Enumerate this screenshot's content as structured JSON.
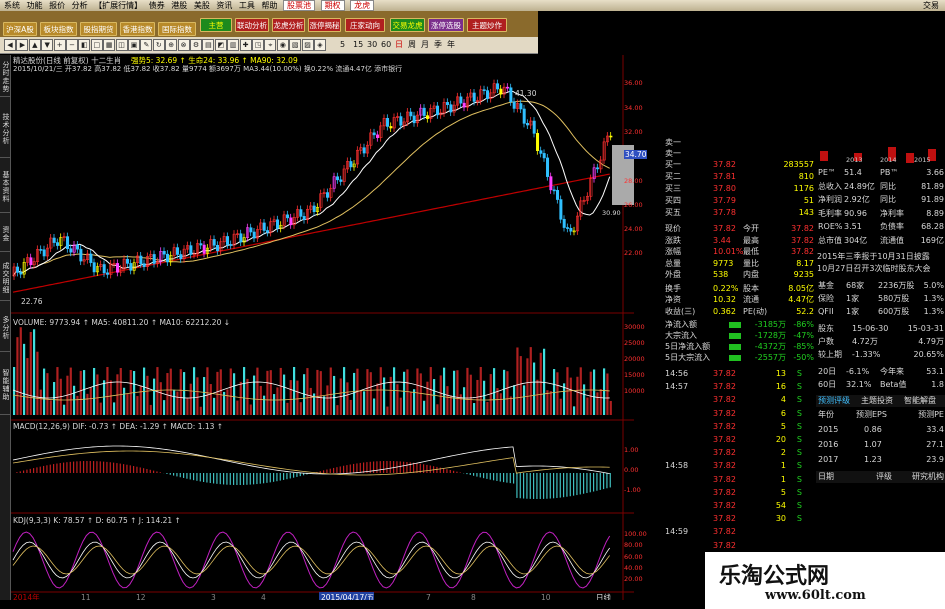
{
  "menubar": {
    "items": [
      "系统",
      "功能",
      "报价",
      "分析",
      "【扩展行情】",
      "资讯",
      "工具",
      "帮助"
    ],
    "hl1": "扩展行情",
    "hl2": "债券",
    "hl3": "港股",
    "hl4": "美股",
    "mid": [
      "资讯",
      "工具",
      "帮助"
    ],
    "right_buttons": [
      "股票池",
      "期权",
      "龙虎"
    ],
    "corner": "交易"
  },
  "toolbar1": [
    {
      "label": "沪深A股",
      "style": "bl"
    },
    {
      "label": "板块指数",
      "style": "bl"
    },
    {
      "label": "股指期货",
      "style": "bl"
    },
    {
      "label": "香港指数",
      "style": "bl"
    },
    {
      "label": "国际指数",
      "style": "bl"
    },
    {
      "label": "主营",
      "style": "gr"
    },
    {
      "label": "联动分析",
      "style": "rd"
    },
    {
      "label": "龙虎分析",
      "style": "rd"
    },
    {
      "label": "涨停揭秘",
      "style": "rd"
    },
    {
      "label": "庄家动向",
      "style": "rd"
    },
    {
      "label": "交易龙虎",
      "style": "gr"
    },
    {
      "label": "涨停选股",
      "style": "pu"
    },
    {
      "label": "主题炒作",
      "style": "rd"
    }
  ],
  "toolbar2": {
    "periods": [
      "5",
      "15",
      "30",
      "60",
      "日",
      "周",
      "月",
      "季",
      "年"
    ]
  },
  "sidebar": [
    "分时走势",
    "技术分析",
    "基本资料",
    "资金",
    "成交明细",
    "多分析",
    "智能辅助"
  ],
  "stock": {
    "name_line": "精达股份(日线 前复权) 十二生肖",
    "indicators": "强势5: 32.69 ↑ 生命24: 33.96 ↑ MA90: 32.09",
    "date_line": "2015/10/21/三  开37.82 高37.82 低37.82 收37.82 量9774 额3697万 MA3.44(10.00%) 换0.22% 流通4.47亿 添市银行",
    "low_label": "22.76",
    "hi_label": "41.30",
    "tag_low": "45"
  },
  "price_axis": [
    "36.00",
    "34.00",
    "32.00",
    "30.00",
    "28.00",
    "26.00",
    "24.00",
    "22.00"
  ],
  "price_box": "34.70",
  "price_box2": "30.90",
  "volume": {
    "header": "VOLUME: 9773.94 ↑ MA5: 40811.20 ↑ MA10: 62212.20 ↓",
    "axis": [
      "30000",
      "25000",
      "20000",
      "15000",
      "10000"
    ],
    "unit": "×100"
  },
  "macd": {
    "header": "MACD(12,26,9) DIF: -0.73 ↑ DEA: -1.29 ↑ MACD: 1.13 ↑",
    "axis": [
      "1.00",
      "0.00",
      "-1.00"
    ]
  },
  "kdj": {
    "header": "KDJ(9,3,3) K: 78.57 ↑ D: 60.75 ↑ J: 114.21 ↑",
    "axis": [
      "100.00",
      "80.00",
      "60.00",
      "40.00",
      "20.00"
    ]
  },
  "xaxis": [
    {
      "t": "2014年",
      "c": "#c00000"
    },
    {
      "t": "11",
      "c": "#888"
    },
    {
      "t": "12",
      "c": "#888"
    },
    {
      "t": "3",
      "c": "#888"
    },
    {
      "t": "4",
      "c": "#888"
    },
    {
      "t": "2015/04/17/五",
      "c": "#4040ff"
    },
    {
      "t": "7",
      "c": "#888"
    },
    {
      "t": "8",
      "c": "#888"
    },
    {
      "t": "10",
      "c": "#888"
    },
    {
      "t": "日线",
      "c": "#ddd"
    }
  ],
  "orderbook": {
    "sell": [
      {
        "l": "卖一",
        "p": "",
        "v": ""
      },
      {
        "l": "卖一",
        "p": "",
        "v": ""
      }
    ],
    "buy": [
      {
        "l": "买一",
        "p": "37.82",
        "v": "283557"
      },
      {
        "l": "买二",
        "p": "37.81",
        "v": "810"
      },
      {
        "l": "买三",
        "p": "37.80",
        "v": "1176"
      },
      {
        "l": "买四",
        "p": "37.79",
        "v": "51"
      },
      {
        "l": "买五",
        "p": "37.78",
        "v": "143"
      }
    ]
  },
  "quote": [
    {
      "a": "现价",
      "b": "37.82",
      "c": "今开",
      "d": "37.82"
    },
    {
      "a": "涨跌",
      "b": "3.44",
      "c": "最高",
      "d": "37.82"
    },
    {
      "a": "涨幅",
      "b": "10.01%",
      "c": "最低",
      "d": "37.82"
    },
    {
      "a": "总量",
      "b": "9773",
      "c": "量比",
      "d": "8.17"
    },
    {
      "a": "外盘",
      "b": "538",
      "c": "内盘",
      "d": "9235"
    },
    {
      "a": "换手",
      "b": "0.22%",
      "c": "股本",
      "d": "8.05亿"
    },
    {
      "a": "净资",
      "b": "10.32",
      "c": "流通",
      "d": "4.47亿"
    },
    {
      "a": "收益(三)",
      "b": "0.362",
      "c": "PE(动)",
      "d": "52.2"
    }
  ],
  "flows": [
    {
      "l": "净流入额",
      "v": "-3185万",
      "p": "-86%"
    },
    {
      "l": "大宗流入",
      "v": "-1728万",
      "p": "-47%"
    },
    {
      "l": "5日净流入额",
      "v": "-4372万",
      "p": "-85%"
    },
    {
      "l": "5日大宗流入",
      "v": "-2557万",
      "p": "-50%"
    }
  ],
  "ticks": [
    {
      "t": "14:56",
      "p": "37.82",
      "v": "13",
      "s": "S"
    },
    {
      "t": "14:57",
      "p": "37.82",
      "v": "16",
      "s": "S"
    },
    {
      "t": "",
      "p": "37.82",
      "v": "4",
      "s": "S"
    },
    {
      "t": "",
      "p": "37.82",
      "v": "6",
      "s": "S"
    },
    {
      "t": "",
      "p": "37.82",
      "v": "5",
      "s": "S"
    },
    {
      "t": "",
      "p": "37.82",
      "v": "20",
      "s": "S"
    },
    {
      "t": "",
      "p": "37.82",
      "v": "2",
      "s": "S"
    },
    {
      "t": "14:58",
      "p": "37.82",
      "v": "1",
      "s": "S"
    },
    {
      "t": "",
      "p": "37.82",
      "v": "1",
      "s": "S"
    },
    {
      "t": "",
      "p": "37.82",
      "v": "5",
      "s": "S"
    },
    {
      "t": "",
      "p": "37.82",
      "v": "54",
      "s": "S"
    },
    {
      "t": "",
      "p": "37.82",
      "v": "30",
      "s": "S"
    },
    {
      "t": "14:59",
      "p": "37.82",
      "v": "",
      "s": ""
    },
    {
      "t": "",
      "p": "37.82",
      "v": "",
      "s": ""
    }
  ],
  "fin": {
    "years": [
      "2013",
      "2014",
      "2015"
    ],
    "rows": [
      {
        "a": "PE™",
        "b": "51.4",
        "c": "PB™",
        "d": "3.66"
      },
      {
        "a": "总收入",
        "b": "24.89亿",
        "c": "同比",
        "d": "81.89"
      },
      {
        "a": "净利润",
        "b": "2.92亿",
        "c": "同比",
        "d": "91.89"
      },
      {
        "a": "毛利率",
        "b": "90.96",
        "c": "净利率",
        "d": "8.89"
      },
      {
        "a": "ROE%",
        "b": "3.51",
        "c": "负债率",
        "d": "68.28"
      },
      {
        "a": "总市值",
        "b": "304亿",
        "c": "流通值",
        "d": "169亿"
      }
    ],
    "report1": "2015年三季报于10月31日披露",
    "report2": "10月27日召开3次临时股东大会",
    "holders": [
      {
        "a": "基金",
        "b": "68家",
        "c": "2236万股",
        "d": "5.0%"
      },
      {
        "a": "保险",
        "b": "1家",
        "c": "580万股",
        "d": "1.3%"
      },
      {
        "a": "QFII",
        "b": "1家",
        "c": "600万股",
        "d": "1.3%"
      }
    ],
    "sh_head": {
      "a": "股东",
      "b": "15-06-30",
      "c": "15-03-31"
    },
    "sh_rows": [
      {
        "a": "户数",
        "b": "4.72万",
        "c": "4.79万"
      },
      {
        "a": "较上期",
        "b": "-1.33%",
        "c": "20.65%"
      }
    ],
    "perf": [
      {
        "a": "20日",
        "b": "-6.1%",
        "c": "今年来",
        "d": "53.1"
      },
      {
        "a": "60日",
        "b": "32.1%",
        "c": "Beta值",
        "d": "1.8"
      }
    ],
    "tabs": [
      "预测评级",
      "主题投资",
      "智能解盘"
    ],
    "fc_head": {
      "a": "年份",
      "b": "预测EPS",
      "c": "预测PE"
    },
    "fc": [
      {
        "a": "2015",
        "b": "0.86",
        "c": "33.4"
      },
      {
        "a": "2016",
        "b": "1.07",
        "c": "27.1"
      },
      {
        "a": "2017",
        "b": "1.23",
        "c": "23.9"
      }
    ],
    "foot": {
      "a": "日期",
      "b": "评级",
      "c": "研究机构"
    }
  },
  "watermark": {
    "title": "乐淘公式网",
    "url": "www.60lt.com"
  }
}
